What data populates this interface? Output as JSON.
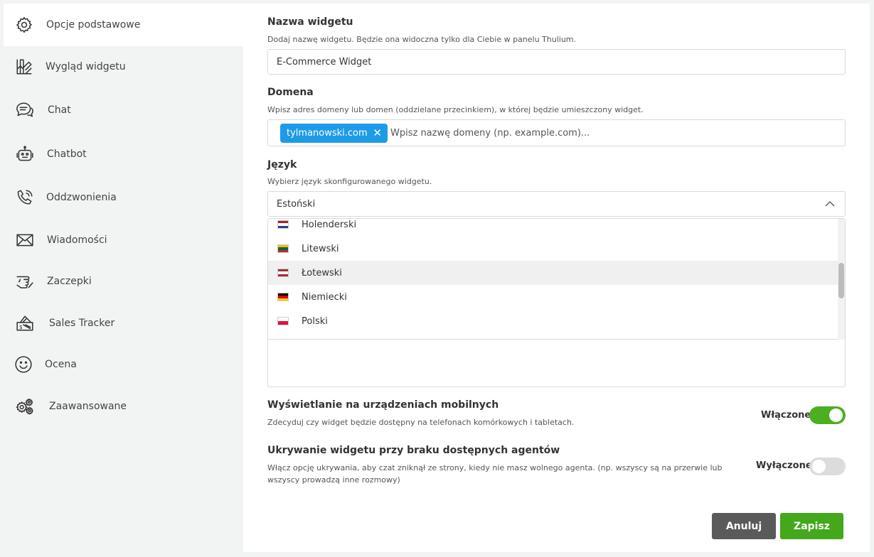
{
  "sidebar": {
    "items": [
      {
        "label": "Opcje podstawowe",
        "icon": "gear-icon"
      },
      {
        "label": "Wygląd widgetu",
        "icon": "palette-icon"
      },
      {
        "label": "Chat",
        "icon": "chat-bubbles-icon"
      },
      {
        "label": "Chatbot",
        "icon": "robot-icon"
      },
      {
        "label": "Oddzwonienia",
        "icon": "phone-callback-icon"
      },
      {
        "label": "Wiadomości",
        "icon": "envelope-icon"
      },
      {
        "label": "Zaczepki",
        "icon": "hand-point-icon"
      },
      {
        "label": "Sales Tracker",
        "icon": "price-tag-icon"
      },
      {
        "label": "Ocena",
        "icon": "smiley-icon"
      },
      {
        "label": "Zaawansowane",
        "icon": "gears-icon"
      }
    ],
    "active_index": 0
  },
  "form": {
    "name": {
      "title": "Nazwa widgetu",
      "description": "Dodaj nazwę widgetu. Będzie ona widoczna tylko dla Ciebie w panelu Thulium.",
      "value": "E-Commerce Widget"
    },
    "domain": {
      "title": "Domena",
      "description": "Wpisz adres domeny lub domen (oddzielane przecinkiem), w której będzie umieszczony widget.",
      "tag": "tylmanowski.com",
      "placeholder": "Wpisz nazwę domeny (np. example.com)..."
    },
    "language": {
      "title": "Język",
      "description": "Wybierz język skonfigurowanego widgetu.",
      "selected": "Estoński",
      "options": [
        {
          "label": "Holenderski",
          "flag": [
            "#ae1c28",
            "#ffffff",
            "#21468b"
          ]
        },
        {
          "label": "Litewski",
          "flag": [
            "#fdb913",
            "#006a44",
            "#c1272d"
          ]
        },
        {
          "label": "Łotewski",
          "flag": [
            "#9e3039",
            "#ffffff",
            "#9e3039"
          ]
        },
        {
          "label": "Niemiecki",
          "flag": [
            "#000000",
            "#dd0000",
            "#ffce00"
          ]
        },
        {
          "label": "Polski",
          "flag": [
            "#ffffff",
            "#dc143c"
          ]
        }
      ],
      "hovered_index": 2
    },
    "mobile": {
      "title": "Wyświetlanie na urządzeniach mobilnych",
      "description": "Zdecyduj czy widget będzie dostępny na telefonach komórkowych i tabletach.",
      "status": "Włączone",
      "enabled": true
    },
    "hide": {
      "title": "Ukrywanie widgetu przy braku dostępnych agentów",
      "description": "Włącz opcję ukrywania, aby czat zniknął ze strony, kiedy nie masz wolnego agenta. (np. wszyscy są na przerwie lub wszyscy prowadzą inne rozmowy)",
      "status": "Wyłączone",
      "enabled": false
    }
  },
  "actions": {
    "cancel_label": "Anuluj",
    "save_label": "Zapisz"
  },
  "colors": {
    "accent_blue": "#1e9be6",
    "toggle_on": "#4caf22",
    "save_green": "#43a81c",
    "cancel_gray": "#5a5a5a"
  }
}
